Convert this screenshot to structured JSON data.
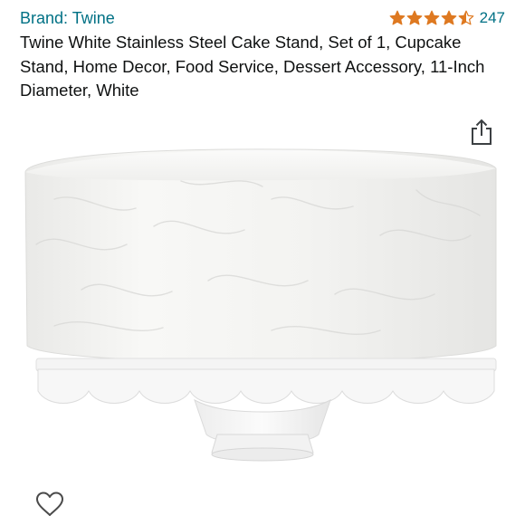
{
  "product": {
    "brand_label": "Brand: Twine",
    "rating": {
      "stars_value": 4.5,
      "stars_max": 5,
      "count": "247",
      "star_color": "#de7921"
    },
    "title": "Twine White Stainless Steel Cake Stand, Set of 1, Cupcake Stand, Home Decor, Food Service, Dessert Accessory, 11-Inch Diameter, White"
  },
  "actions": {
    "share_icon": "share-icon",
    "wishlist_icon": "heart-outline-icon"
  },
  "colors": {
    "link": "#007185",
    "text": "#0f1111"
  }
}
